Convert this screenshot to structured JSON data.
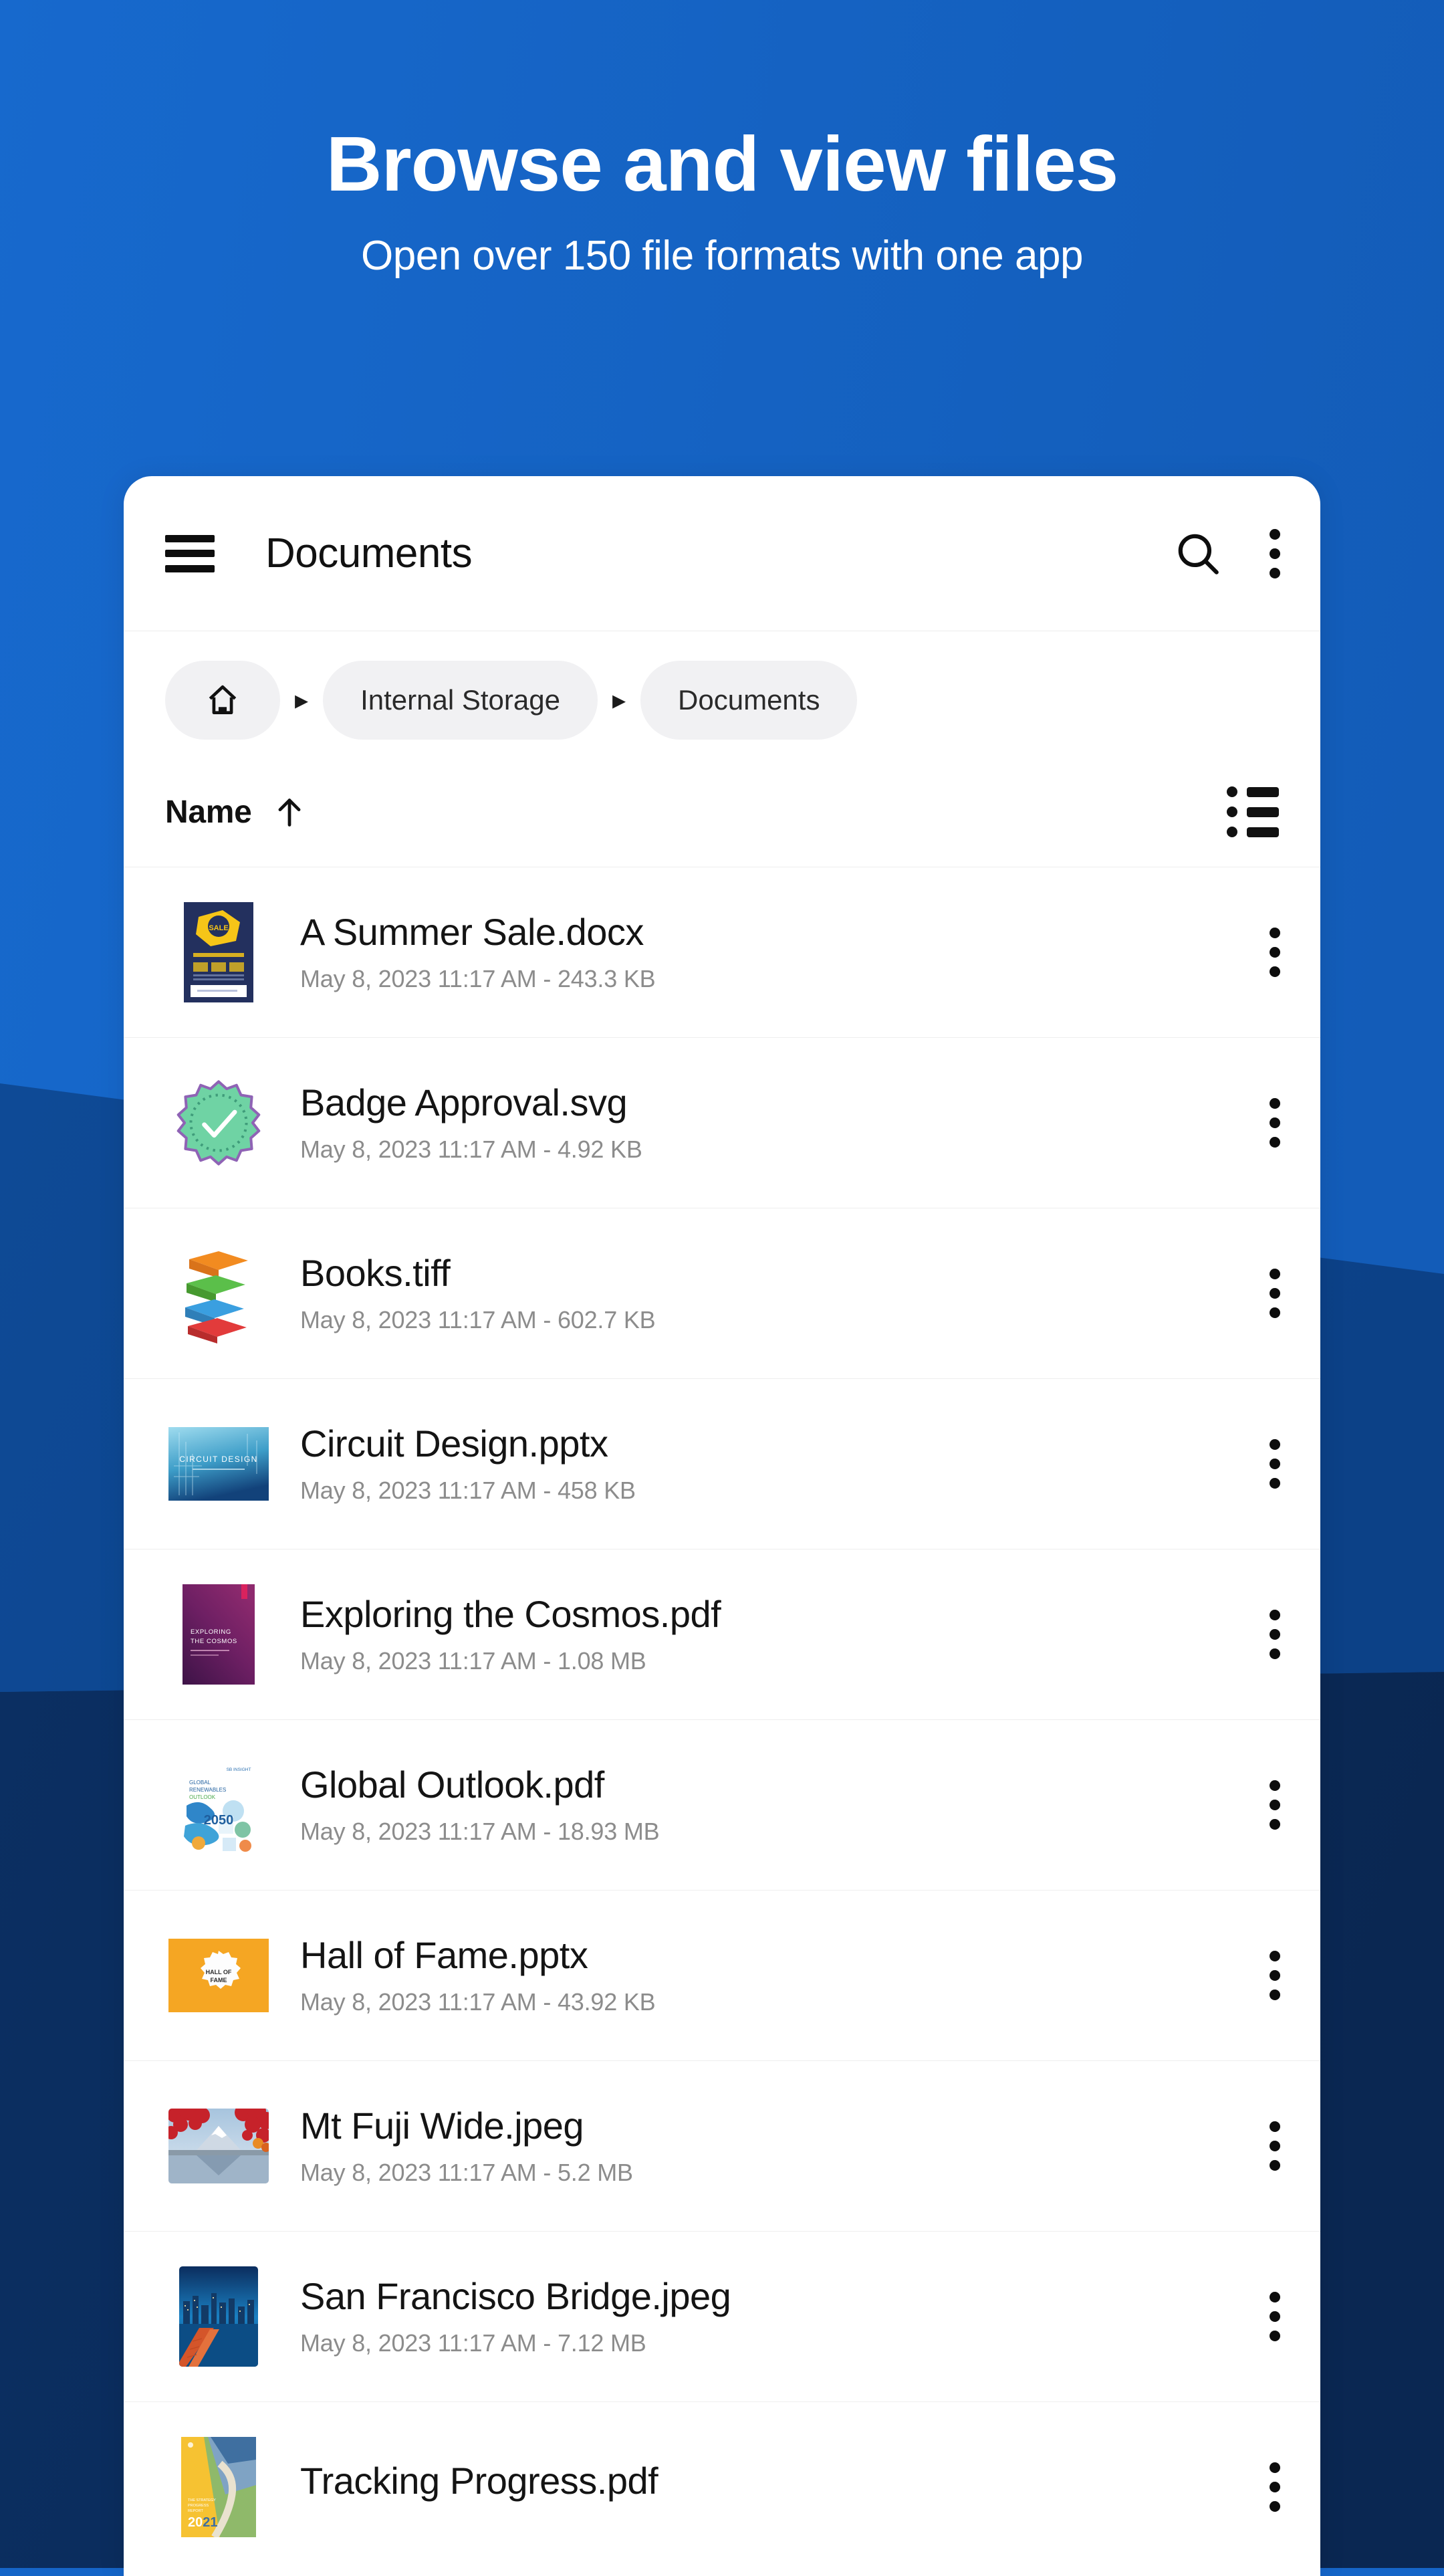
{
  "hero": {
    "title": "Browse and view files",
    "subtitle": "Open over 150 file formats with one app"
  },
  "colors": {
    "band_light": "#1565c8",
    "band_mid": "#0d4792",
    "band_dark": "#0c2d5e",
    "card": "#ffffff",
    "chip": "#f1f1f3",
    "text_primary": "#141414",
    "text_secondary": "#8c8c8c"
  },
  "appbar": {
    "menu_icon": "hamburger-menu-icon",
    "title": "Documents",
    "search_icon": "search-icon",
    "overflow_icon": "more-vert-icon"
  },
  "breadcrumb": {
    "home_icon": "home-icon",
    "separator": "▸",
    "items": [
      {
        "label": "Internal Storage"
      },
      {
        "label": "Documents"
      }
    ]
  },
  "sortbar": {
    "label": "Name",
    "direction_icon": "arrow-up-icon",
    "view_toggle_icon": "list-view-icon"
  },
  "files": [
    {
      "name": "A Summer Sale.docx",
      "meta": "May 8, 2023 11:17 AM - 243.3 KB",
      "date": "May 8, 2023 11:17 AM",
      "size": "243.3 KB",
      "type": "docx",
      "thumb": "summer-sale-doc-thumb"
    },
    {
      "name": "Badge Approval.svg",
      "meta": "May 8, 2023 11:17 AM - 4.92 KB",
      "date": "May 8, 2023 11:17 AM",
      "size": "4.92 KB",
      "type": "svg",
      "thumb": "badge-check-thumb"
    },
    {
      "name": "Books.tiff",
      "meta": "May 8, 2023 11:17 AM - 602.7 KB",
      "date": "May 8, 2023 11:17 AM",
      "size": "602.7 KB",
      "type": "tiff",
      "thumb": "books-stack-thumb"
    },
    {
      "name": "Circuit Design.pptx",
      "meta": "May 8, 2023 11:17 AM - 458 KB",
      "date": "May 8, 2023 11:17 AM",
      "size": "458 KB",
      "type": "pptx",
      "thumb": "circuit-design-slide-thumb"
    },
    {
      "name": "Exploring the Cosmos.pdf",
      "meta": "May 8, 2023 11:17 AM - 1.08 MB",
      "date": "May 8, 2023 11:17 AM",
      "size": "1.08 MB",
      "type": "pdf",
      "thumb": "exploring-cosmos-cover-thumb"
    },
    {
      "name": "Global Outlook.pdf",
      "meta": "May 8, 2023 11:17 AM - 18.93 MB",
      "date": "May 8, 2023 11:17 AM",
      "size": "18.93 MB",
      "type": "pdf",
      "thumb": "global-outlook-2050-thumb"
    },
    {
      "name": "Hall of Fame.pptx",
      "meta": "May 8, 2023 11:17 AM - 43.92 KB",
      "date": "May 8, 2023 11:17 AM",
      "size": "43.92 KB",
      "type": "pptx",
      "thumb": "hall-of-fame-slide-thumb"
    },
    {
      "name": "Mt Fuji Wide.jpeg",
      "meta": "May 8, 2023 11:17 AM - 5.2 MB",
      "date": "May 8, 2023 11:17 AM",
      "size": "5.2 MB",
      "type": "jpeg",
      "thumb": "mt-fuji-photo-thumb"
    },
    {
      "name": "San Francisco Bridge.jpeg",
      "meta": "May 8, 2023 11:17 AM - 7.12 MB",
      "date": "May 8, 2023 11:17 AM",
      "size": "7.12 MB",
      "type": "jpeg",
      "thumb": "san-francisco-photo-thumb"
    },
    {
      "name": "Tracking Progress.pdf",
      "meta": "",
      "date": "",
      "size": "",
      "type": "pdf",
      "thumb": "tracking-progress-2021-thumb"
    }
  ],
  "row_overflow_icon": "more-vert-icon"
}
